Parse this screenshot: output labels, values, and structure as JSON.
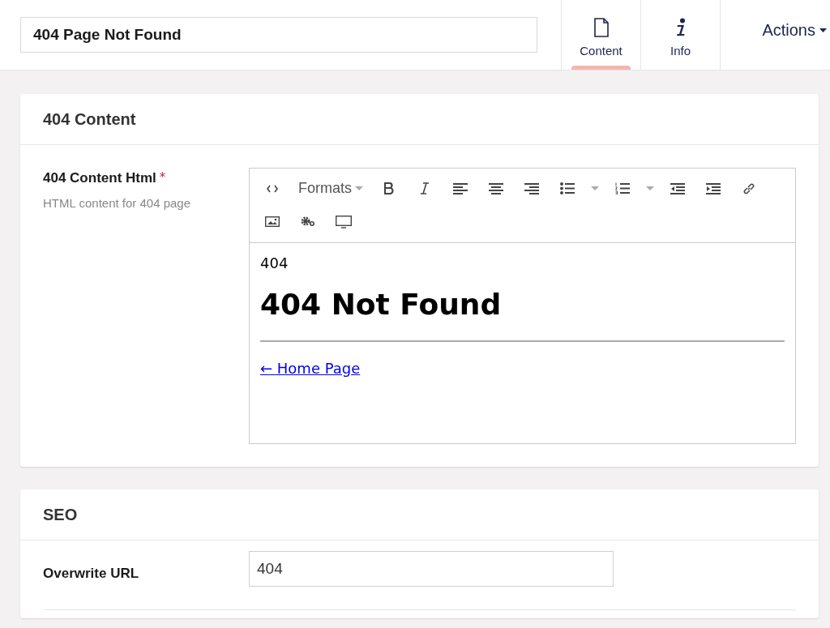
{
  "header": {
    "title_value": "404 Page Not Found",
    "tabs": [
      {
        "label": "Content",
        "selected": true
      },
      {
        "label": "Info",
        "selected": false
      }
    ],
    "actions": "Actions"
  },
  "sections": [
    {
      "title": "404 Content",
      "field": {
        "label": "404 Content Html",
        "required_mark": "*",
        "description": "HTML content for 404 page",
        "kind": "richtext",
        "toolbar": [
          [
            {
              "kind": "code"
            },
            {
              "kind": "formats",
              "label": "Formats"
            },
            {
              "kind": "bold"
            },
            {
              "kind": "italic"
            },
            {
              "kind": "align-left"
            },
            {
              "kind": "align-center"
            },
            {
              "kind": "align-right"
            },
            {
              "kind": "bullet-list"
            },
            {
              "kind": "caret"
            },
            {
              "kind": "numbered-list"
            },
            {
              "kind": "caret"
            },
            {
              "kind": "outdent"
            },
            {
              "kind": "indent"
            },
            {
              "kind": "link"
            }
          ],
          [
            {
              "kind": "image"
            },
            {
              "kind": "settings"
            },
            {
              "kind": "preview"
            }
          ]
        ],
        "content": [
          {
            "kind": "paragraph",
            "text": "404"
          },
          {
            "kind": "heading",
            "text": "404 Not Found"
          },
          {
            "kind": "rule"
          },
          {
            "kind": "link",
            "text": "← Home Page"
          }
        ]
      }
    },
    {
      "title": "SEO",
      "field": {
        "label": "Overwrite URL",
        "kind": "text",
        "value": "404"
      }
    }
  ]
}
